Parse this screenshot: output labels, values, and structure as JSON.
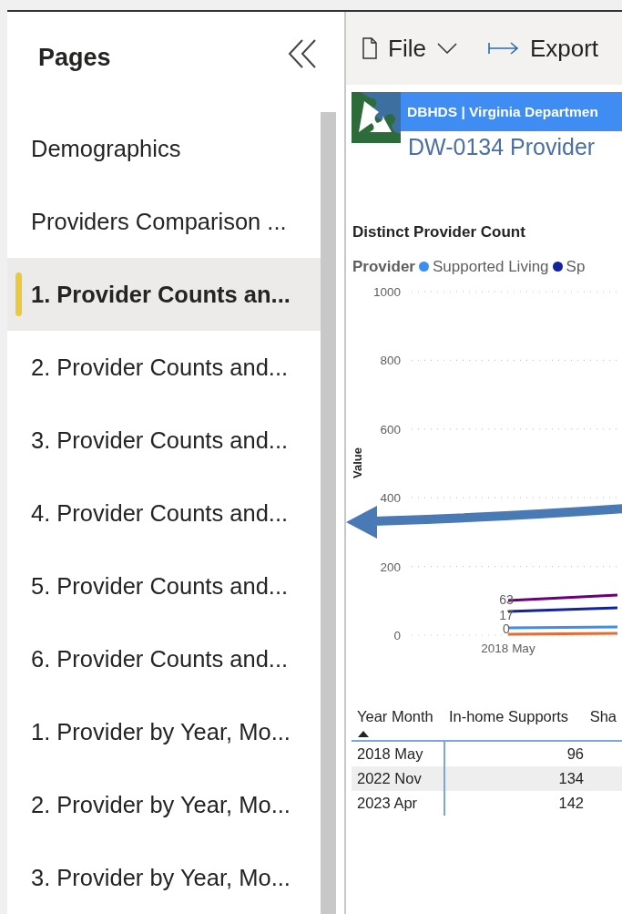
{
  "pages_panel": {
    "title": "Pages",
    "pages": [
      {
        "label": "Demographics",
        "selected": false
      },
      {
        "label": "Providers Comparison ...",
        "selected": false
      },
      {
        "label": "1. Provider Counts an...",
        "selected": true
      },
      {
        "label": "2. Provider Counts and...",
        "selected": false
      },
      {
        "label": "3. Provider Counts and...",
        "selected": false
      },
      {
        "label": "4. Provider Counts and...",
        "selected": false
      },
      {
        "label": "5. Provider Counts and...",
        "selected": false
      },
      {
        "label": "6. Provider Counts and...",
        "selected": false
      },
      {
        "label": "1. Provider by Year, Mo...",
        "selected": false
      },
      {
        "label": "2. Provider by Year, Mo...",
        "selected": false
      },
      {
        "label": "3. Provider by Year, Mo...",
        "selected": false
      }
    ]
  },
  "toolbar": {
    "items": [
      {
        "kind": "file",
        "label": "File"
      },
      {
        "kind": "export",
        "label": "Export"
      }
    ]
  },
  "report": {
    "banner": "DBHDS | Virginia Departmen",
    "title": "DW-0134 Provider",
    "chart": {
      "title": "Distinct Provider Count",
      "legend_title": "Provider",
      "legend": [
        {
          "label": "Supported Living",
          "color": "#3c8ef2"
        },
        {
          "label": "Sp",
          "color": "#12239e"
        }
      ],
      "y_axis_title": "Value",
      "y_axis_labels": [
        "1000",
        "800",
        "600",
        "400",
        "200",
        "0"
      ],
      "x_axis_labels": [
        "2018 May"
      ],
      "data_labels": [
        "63",
        "17",
        "0"
      ]
    },
    "table": {
      "columns": [
        {
          "label": "Year Month",
          "sorted": true
        },
        {
          "label": "In-home Supports",
          "sorted": false
        },
        {
          "label": "Sha",
          "sorted": false
        }
      ],
      "rows": [
        [
          "2018 May",
          "96"
        ],
        [
          "2022 Nov",
          "134"
        ],
        [
          "2023 Apr",
          "142"
        ]
      ]
    }
  }
}
